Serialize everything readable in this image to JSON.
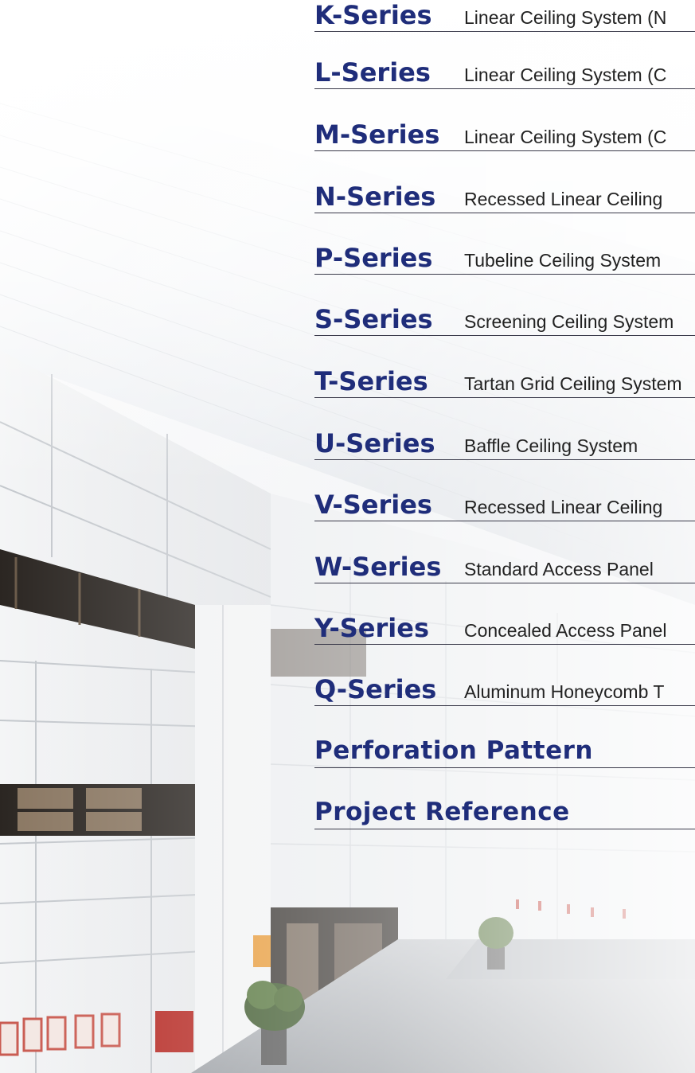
{
  "series": [
    {
      "code": "K-Series",
      "description": "Linear Ceiling System (N"
    },
    {
      "code": "L-Series",
      "description": "Linear Ceiling System (C"
    },
    {
      "code": "M-Series",
      "description": "Linear Ceiling System (C"
    },
    {
      "code": "N-Series",
      "description": "Recessed Linear Ceiling"
    },
    {
      "code": "P-Series",
      "description": "Tubeline Ceiling System"
    },
    {
      "code": "S-Series",
      "description": "Screening Ceiling System"
    },
    {
      "code": "T-Series",
      "description": "Tartan Grid Ceiling System"
    },
    {
      "code": "U-Series",
      "description": "Baffle Ceiling System"
    },
    {
      "code": "V-Series",
      "description": "Recessed Linear Ceiling"
    },
    {
      "code": "W-Series",
      "description": "Standard Access Panel"
    },
    {
      "code": "Y-Series",
      "description": "Concealed Access Panel"
    },
    {
      "code": "Q-Series",
      "description": "Aluminum Honeycomb T"
    }
  ],
  "sections": [
    {
      "title": "Perforation Pattern"
    },
    {
      "title": "Project Reference"
    }
  ],
  "colors": {
    "heading": "#1f2d7a",
    "text": "#222222",
    "rule": "#3a3a4a"
  }
}
